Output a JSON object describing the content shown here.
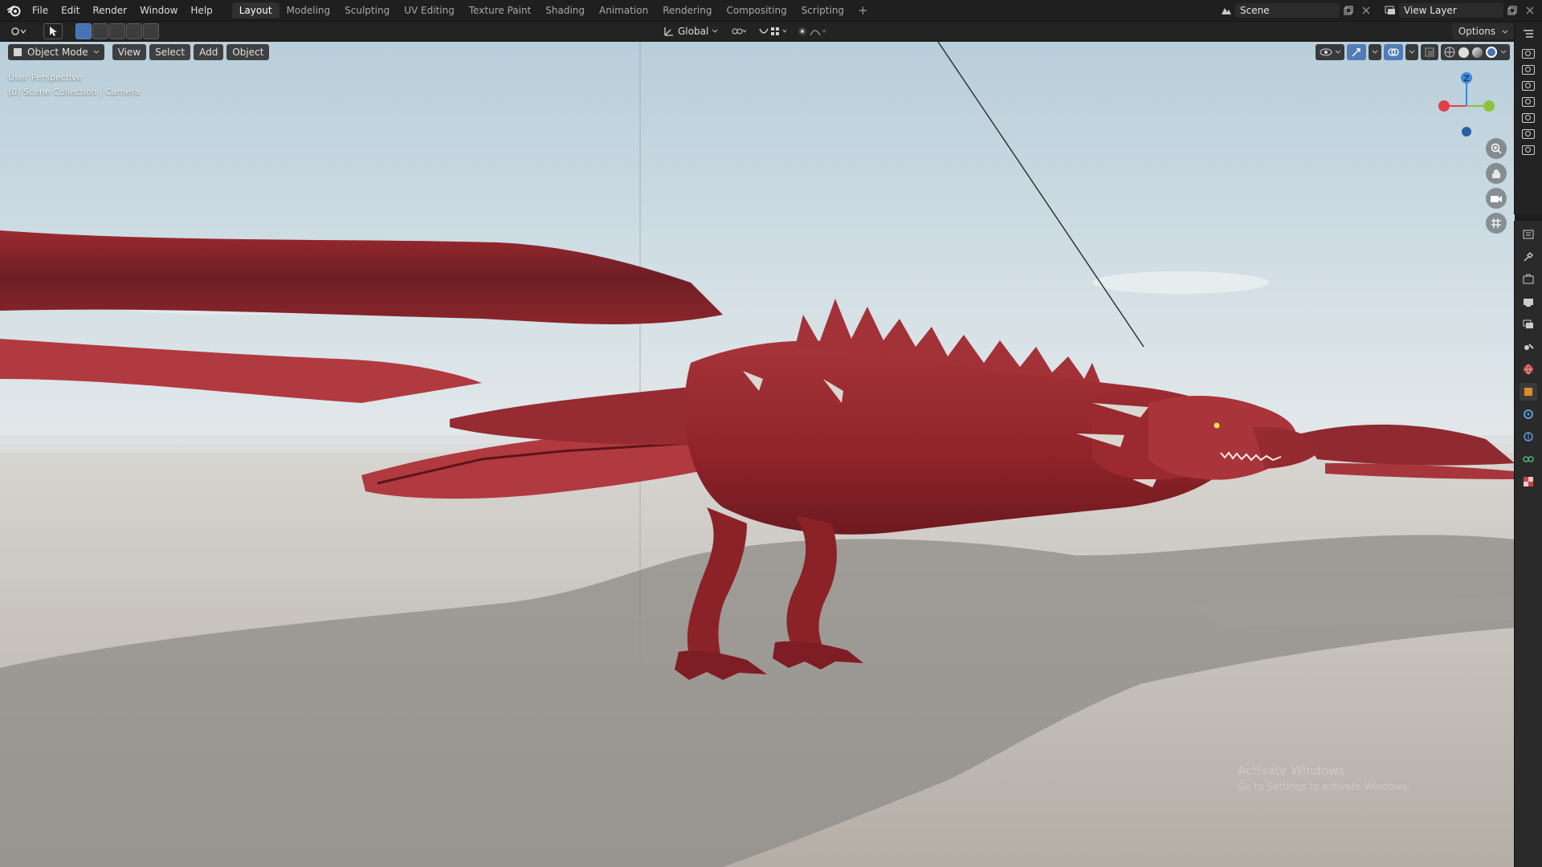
{
  "menu": [
    "File",
    "Edit",
    "Render",
    "Window",
    "Help"
  ],
  "workspace_tabs": [
    {
      "label": "Layout",
      "active": true
    },
    {
      "label": "Modeling",
      "active": false
    },
    {
      "label": "Sculpting",
      "active": false
    },
    {
      "label": "UV Editing",
      "active": false
    },
    {
      "label": "Texture Paint",
      "active": false
    },
    {
      "label": "Shading",
      "active": false
    },
    {
      "label": "Animation",
      "active": false
    },
    {
      "label": "Rendering",
      "active": false
    },
    {
      "label": "Compositing",
      "active": false
    },
    {
      "label": "Scripting",
      "active": false
    }
  ],
  "add_workspace": "+",
  "scene": {
    "name": "Scene"
  },
  "view_layer": {
    "name": "View Layer"
  },
  "toolbar": {
    "transform_orientation": "Global",
    "options_label": "Options"
  },
  "viewport": {
    "mode": "Object Mode",
    "menus": [
      "View",
      "Select",
      "Add",
      "Object"
    ],
    "info_line1": "User Perspective",
    "info_line2": "(0) Scene Collection | Camera",
    "gizmo": {
      "z_label": "Z"
    },
    "watermark_line1": "Activate Windows",
    "watermark_line2": "Go to Settings to activate Windows."
  },
  "colors": {
    "accent": "#4772b3",
    "axis_x": "#e0404a",
    "axis_y": "#8fc23a",
    "axis_z": "#3e86e0",
    "dragon": "#a3282e",
    "sky_top": "#b9cfdc",
    "ground": "#cfcac4"
  },
  "icons": {
    "logo": "blender-logo-icon",
    "scene_browse": "scene-icon",
    "view_layer_browse": "render-layers-icon",
    "zoom": "zoom-icon",
    "pan": "hand-icon",
    "camera": "camera-view-icon",
    "ortho": "grid-icon"
  }
}
